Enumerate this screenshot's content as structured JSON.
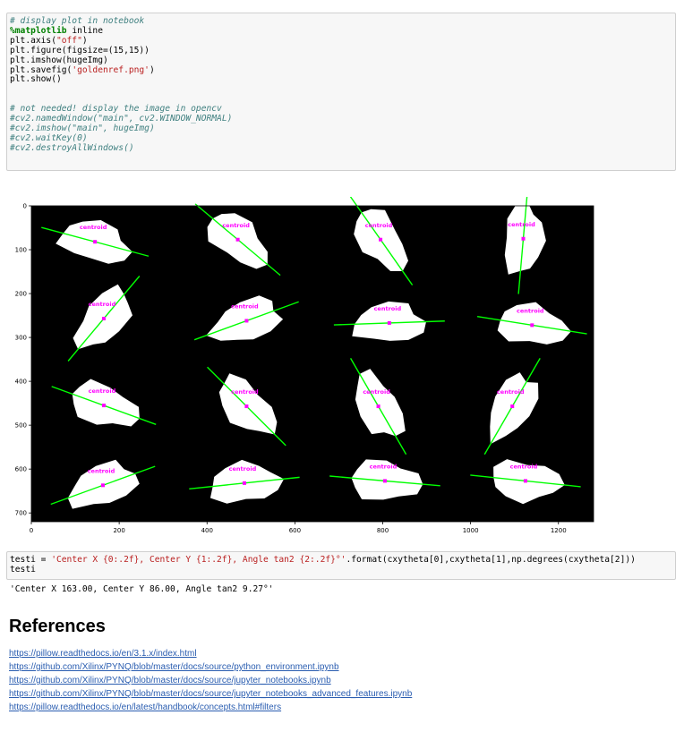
{
  "cell1": {
    "lines": [
      [
        {
          "t": "# display plot in notebook",
          "c": "cm"
        }
      ],
      [
        {
          "t": "%matplotlib",
          "c": "kw"
        },
        {
          "t": " inline",
          "c": ""
        }
      ],
      [
        {
          "t": "plt.axis(",
          "c": ""
        },
        {
          "t": "\"off\"",
          "c": "st"
        },
        {
          "t": ")",
          "c": ""
        }
      ],
      [
        {
          "t": "plt.figure(figsize=(15,15))",
          "c": ""
        }
      ],
      [
        {
          "t": "plt.imshow(hugeImg)",
          "c": ""
        }
      ],
      [
        {
          "t": "plt.savefig(",
          "c": ""
        },
        {
          "t": "'goldenref.png'",
          "c": "st"
        },
        {
          "t": ")",
          "c": ""
        }
      ],
      [
        {
          "t": "plt.show()",
          "c": ""
        }
      ],
      [
        {
          "t": "",
          "c": ""
        }
      ],
      [
        {
          "t": "",
          "c": ""
        }
      ],
      [
        {
          "t": "# not needed! display the image in opencv",
          "c": "cm"
        }
      ],
      [
        {
          "t": "#cv2.namedWindow(\"main\", cv2.WINDOW_NORMAL)",
          "c": "cm"
        }
      ],
      [
        {
          "t": "#cv2.imshow(\"main\", hugeImg)",
          "c": "cm"
        }
      ],
      [
        {
          "t": "#cv2.waitKey(0)",
          "c": "cm"
        }
      ],
      [
        {
          "t": "#cv2.destroyAllWindows()",
          "c": "cm"
        }
      ]
    ]
  },
  "plot": {
    "y_ticks": [
      "0",
      "100",
      "200",
      "300",
      "400",
      "500",
      "600",
      "700"
    ],
    "x_ticks": [
      "0",
      "200",
      "400",
      "600",
      "800",
      "1000",
      "1200"
    ],
    "xlim": [
      0,
      1280
    ],
    "ylim": [
      720,
      0
    ],
    "label": "centroid",
    "colors": {
      "background": "#000000",
      "blob": "#ffffff",
      "line": "#00ff00",
      "centroid": "#ff00ff"
    },
    "panels": [
      {
        "cx": 145,
        "cy": 82,
        "angle": 15
      },
      {
        "cx": 470,
        "cy": 77,
        "angle": 40
      },
      {
        "cx": 795,
        "cy": 77,
        "angle": 55
      },
      {
        "cx": 1120,
        "cy": 75,
        "angle": -85
      },
      {
        "cx": 165,
        "cy": 257,
        "angle": -50
      },
      {
        "cx": 490,
        "cy": 262,
        "angle": -20
      },
      {
        "cx": 815,
        "cy": 267,
        "angle": -2
      },
      {
        "cx": 1140,
        "cy": 272,
        "angle": 9
      },
      {
        "cx": 165,
        "cy": 455,
        "angle": 20
      },
      {
        "cx": 490,
        "cy": 457,
        "angle": 45
      },
      {
        "cx": 790,
        "cy": 457,
        "angle": 60
      },
      {
        "cx": 1095,
        "cy": 457,
        "angle": -60
      },
      {
        "cx": 163,
        "cy": 637,
        "angle": -20
      },
      {
        "cx": 485,
        "cy": 632,
        "angle": -6
      },
      {
        "cx": 805,
        "cy": 627,
        "angle": 5
      },
      {
        "cx": 1125,
        "cy": 627,
        "angle": 6
      }
    ]
  },
  "cell2": {
    "lines": [
      [
        {
          "t": "testi = ",
          "c": ""
        },
        {
          "t": "'Center X {0:.2f}, Center Y {1:.2f}, Angle tan2 {2:.2f}°'",
          "c": "st"
        },
        {
          "t": ".format(cxytheta[0],cxytheta[1],np.degrees(cxytheta[2]))",
          "c": ""
        }
      ],
      [
        {
          "t": "testi",
          "c": ""
        }
      ]
    ]
  },
  "output": "'Center X 163.00, Center Y 86.00, Angle tan2 9.27°'",
  "references": {
    "heading": "References",
    "links": [
      "https://pillow.readthedocs.io/en/3.1.x/index.html",
      "https://github.com/Xilinx/PYNQ/blob/master/docs/source/python_environment.ipynb",
      "https://github.com/Xilinx/PYNQ/blob/master/docs/source/jupyter_notebooks.ipynb",
      "https://github.com/Xilinx/PYNQ/blob/master/docs/source/jupyter_notebooks_advanced_features.ipynb",
      "https://pillow.readthedocs.io/en/latest/handbook/concepts.html#filters"
    ]
  }
}
